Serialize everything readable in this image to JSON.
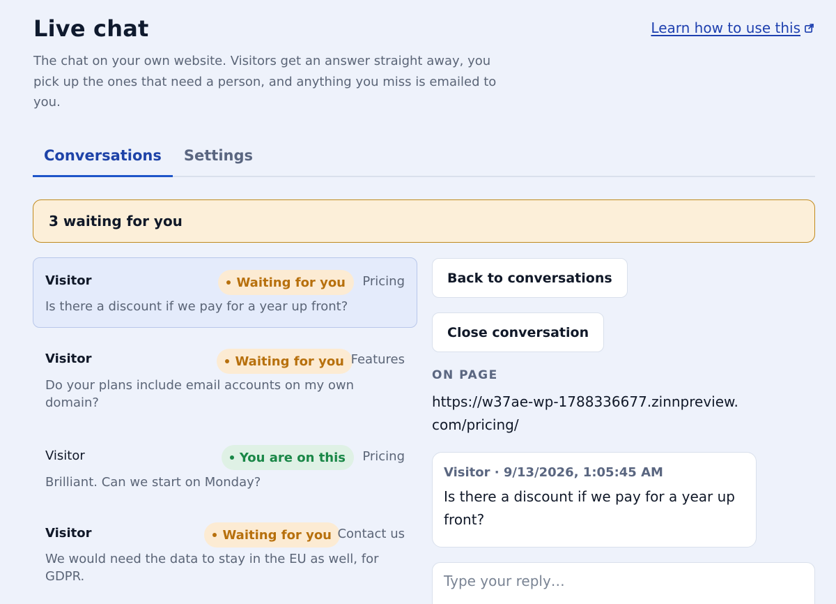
{
  "header": {
    "title": "Live chat",
    "learn_link": "Learn how to use this",
    "intro": "The chat on your own website. Visitors get an answer straight away, you pick up the ones that need a person, and anything you miss is emailed to you."
  },
  "tabs": [
    {
      "label": "Conversations",
      "active": true
    },
    {
      "label": "Settings",
      "active": false
    }
  ],
  "banner": {
    "text": "3 waiting for you"
  },
  "conversations": [
    {
      "who": "Visitor",
      "status": "Waiting for you",
      "status_kind": "waiting",
      "page": "Pricing",
      "snippet": "Is there a discount if we pay for a year up front?",
      "selected": true,
      "unread": true
    },
    {
      "who": "Visitor",
      "status": "Waiting for you",
      "status_kind": "waiting",
      "page": "Features",
      "snippet": "Do your plans include email accounts on my own domain?",
      "selected": false,
      "unread": true
    },
    {
      "who": "Visitor",
      "status": "You are on this",
      "status_kind": "active",
      "page": "Pricing",
      "snippet": "Brilliant. Can we start on Monday?",
      "selected": false,
      "unread": false
    },
    {
      "who": "Visitor",
      "status": "Waiting for you",
      "status_kind": "waiting",
      "page": "Contact us",
      "snippet": "We would need the data to stay in the EU as well, for GDPR.",
      "selected": false,
      "unread": true
    }
  ],
  "detail": {
    "back_label": "Back to conversations",
    "close_label": "Close conversation",
    "on_page_label": "ON PAGE",
    "on_page_url": "https://w37ae-wp-1788336677.zinnpreview.com/pricing/",
    "message": {
      "meta": "Visitor · 9/13/2026, 1:05:45 AM",
      "body": "Is there a discount if we pay for a year up front?"
    },
    "reply_placeholder": "Type your reply…"
  },
  "colors": {
    "background": "#eef2fb",
    "accent": "#1e43a8",
    "waiting": "#b7700d",
    "active": "#1a8747",
    "banner_bg": "#fcefd9"
  }
}
